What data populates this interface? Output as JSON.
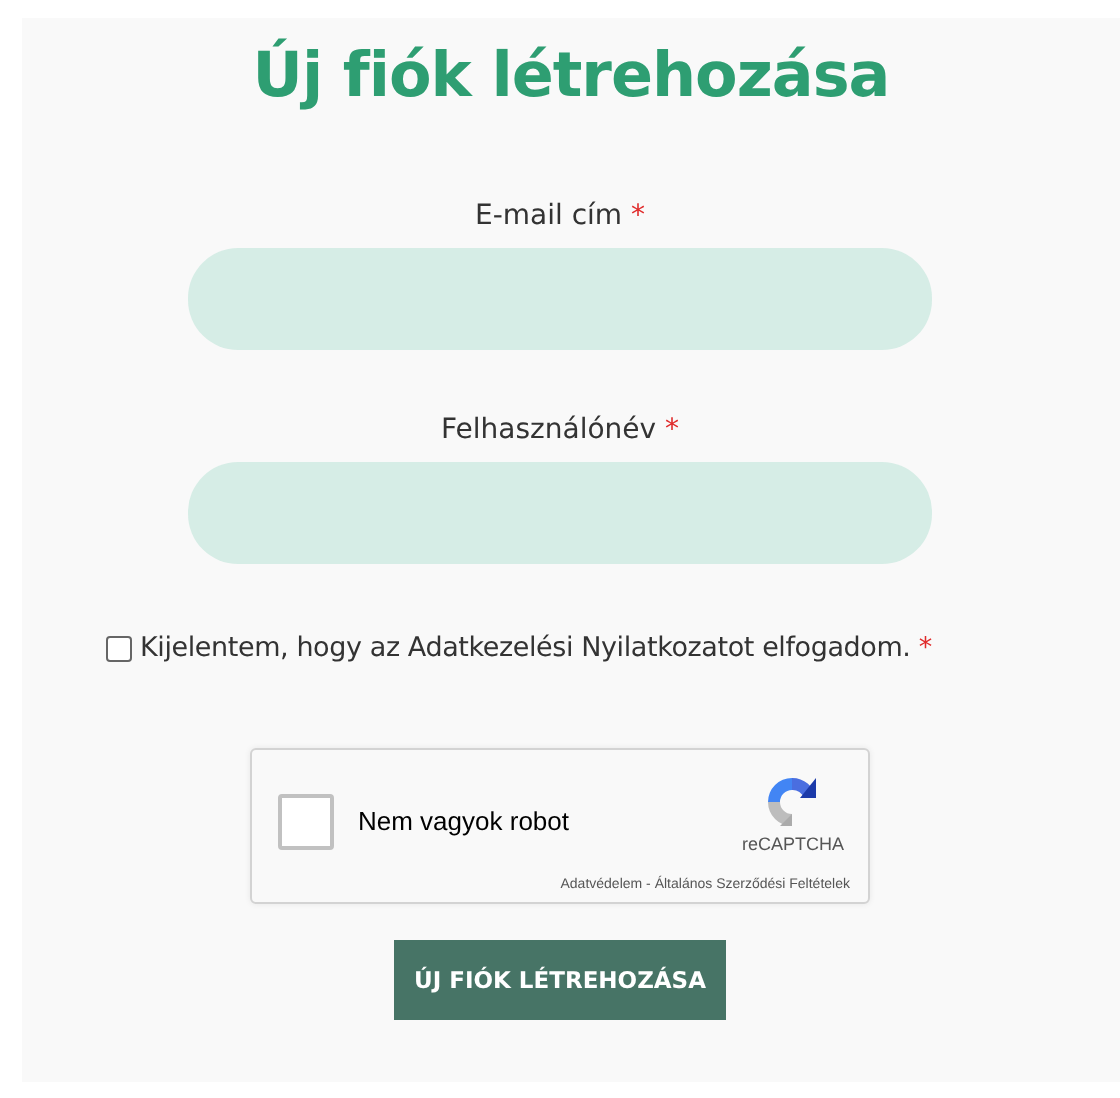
{
  "title": "Új fiók létrehozása",
  "fields": [
    {
      "label": "E-mail cím",
      "required_mark": "*"
    },
    {
      "label": "Felhasználónév",
      "required_mark": "*"
    }
  ],
  "consent": {
    "checked": false,
    "text": "Kijelentem, hogy az Adatkezelési Nyilatkozatot elfogadom.",
    "required_mark": "*"
  },
  "captcha": {
    "checked": false,
    "label": "Nem vagyok robot",
    "brand": "reCAPTCHA",
    "footer": "Adatvédelem - Általános Szerződési Feltételek"
  },
  "submit": "ÚJ FIÓK LÉTREHOZÁSA"
}
